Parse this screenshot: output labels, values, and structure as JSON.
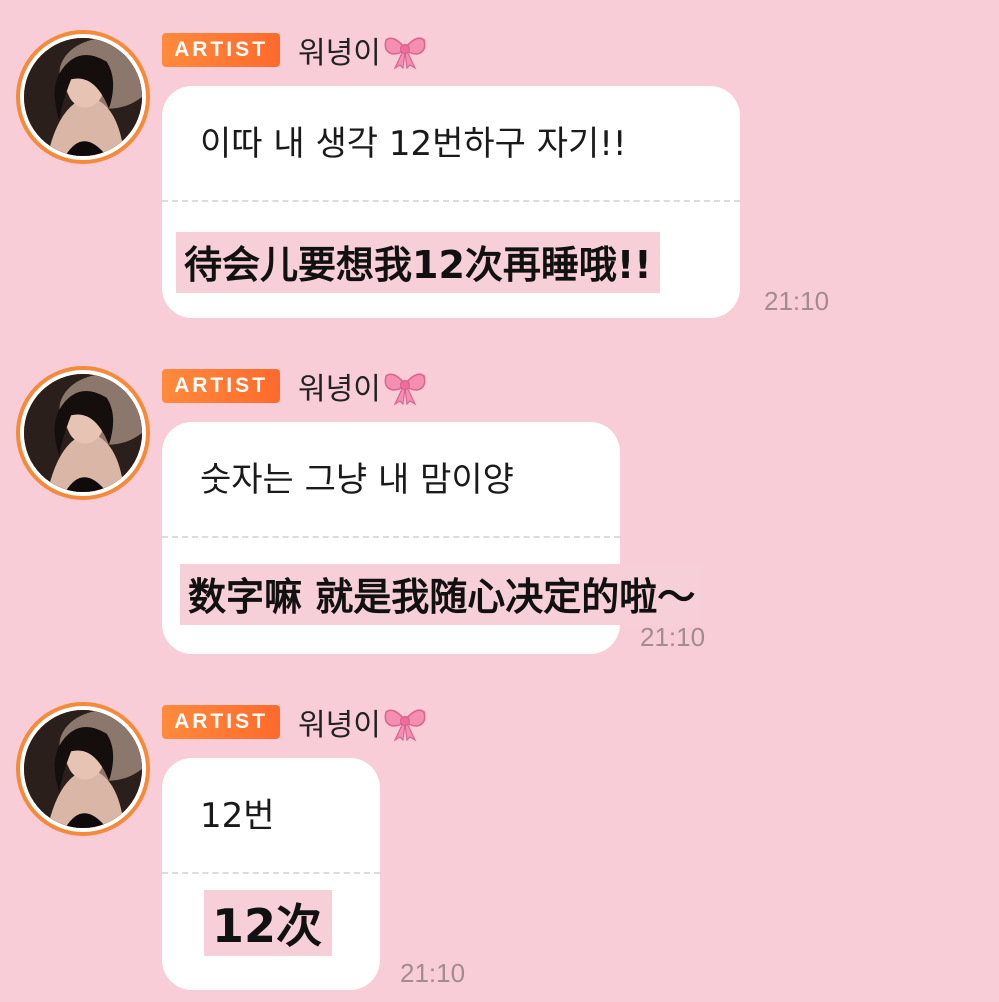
{
  "messages": [
    {
      "badge": "ARTIST",
      "sender": "워녕이",
      "sender_emoji": "bow-icon",
      "text_ko": "이따 내 생각 12번하구 자기!!",
      "text_cn": "待会儿要想我12次再睡哦!!",
      "time": "21:10"
    },
    {
      "badge": "ARTIST",
      "sender": "워녕이",
      "sender_emoji": "bow-icon",
      "text_ko": "숫자는 그냥 내 맘이양",
      "text_cn": "数字嘛 就是我随心决定的啦～",
      "time": "21:10"
    },
    {
      "badge": "ARTIST",
      "sender": "워녕이",
      "sender_emoji": "bow-icon",
      "text_ko": "12번",
      "text_cn": "12次",
      "time": "21:10"
    }
  ],
  "colors": {
    "background": "#f9cdd7",
    "badge": "#ff7a34",
    "avatar_ring": "#f58a3a",
    "bubble": "#ffffff",
    "translation_highlight": "#f7cfd8",
    "time": "#a28c8e"
  }
}
